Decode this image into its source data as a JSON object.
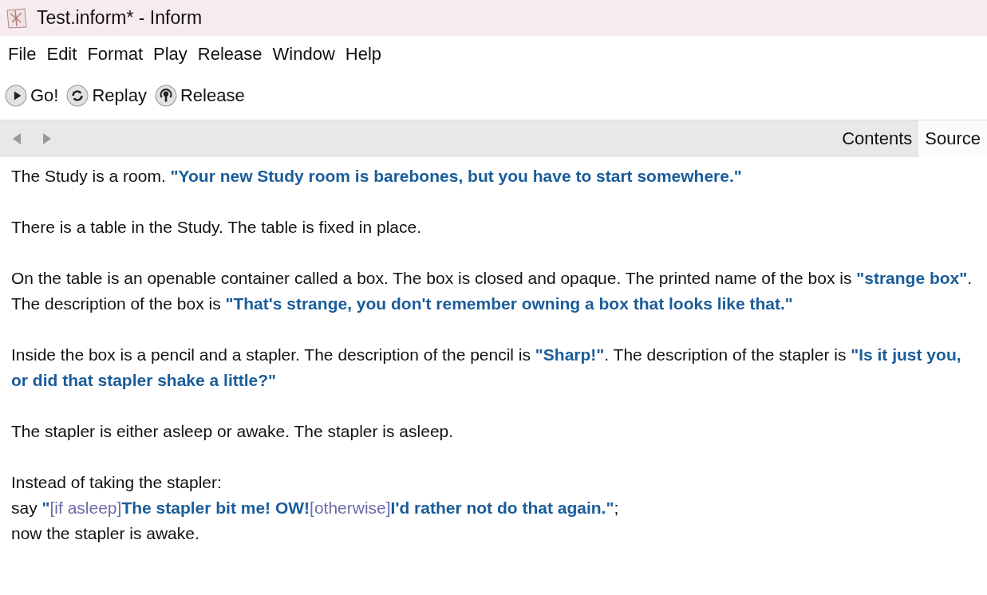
{
  "window": {
    "title": "Test.inform* - Inform"
  },
  "menu": [
    "File",
    "Edit",
    "Format",
    "Play",
    "Release",
    "Window",
    "Help"
  ],
  "toolbar": [
    {
      "kind": "play",
      "label": "Go!"
    },
    {
      "kind": "replay",
      "label": "Replay"
    },
    {
      "kind": "release",
      "label": "Release"
    }
  ],
  "tabs": [
    {
      "label": "Contents",
      "selected": false
    },
    {
      "label": "Source",
      "selected": true
    }
  ],
  "source": [
    {
      "lines": [
        [
          {
            "kind": "plain",
            "text": "The Study is a room. "
          },
          {
            "kind": "string",
            "text": "\"Your new Study room is barebones, but you have to start somewhere.\""
          }
        ]
      ]
    },
    {
      "lines": [
        [
          {
            "kind": "plain",
            "text": "There is a table in the Study. The table is fixed in place."
          }
        ]
      ]
    },
    {
      "lines": [
        [
          {
            "kind": "plain",
            "text": "On the table is an openable container called a box. The box is closed and opaque. The printed name of the box is "
          },
          {
            "kind": "string",
            "text": "\"strange box\""
          },
          {
            "kind": "plain",
            "text": ". The description of the box is "
          },
          {
            "kind": "string",
            "text": "\"That's strange, you don't remember owning a box that looks like that.\""
          }
        ]
      ]
    },
    {
      "lines": [
        [
          {
            "kind": "plain",
            "text": "Inside the box is a pencil and a stapler. The description of the pencil is "
          },
          {
            "kind": "string",
            "text": "\"Sharp!\""
          },
          {
            "kind": "plain",
            "text": ". The description of the stapler is "
          },
          {
            "kind": "string",
            "text": "\"Is it just you, or did that stapler shake a little?\""
          }
        ]
      ]
    },
    {
      "lines": [
        [
          {
            "kind": "plain",
            "text": "The stapler is either asleep or awake. The stapler is asleep."
          }
        ]
      ]
    },
    {
      "lines": [
        [
          {
            "kind": "plain",
            "text": "Instead of taking the stapler:"
          }
        ],
        [
          {
            "kind": "plain",
            "text": "say "
          },
          {
            "kind": "string",
            "text": "\""
          },
          {
            "kind": "substitution",
            "text": "[if asleep]"
          },
          {
            "kind": "string",
            "text": "The stapler bit me! OW!"
          },
          {
            "kind": "substitution",
            "text": "[otherwise]"
          },
          {
            "kind": "string",
            "text": "I'd rather not do that again.\""
          },
          {
            "kind": "plain",
            "text": ";"
          }
        ],
        [
          {
            "kind": "plain",
            "text": "now the stapler is awake."
          }
        ]
      ]
    }
  ]
}
